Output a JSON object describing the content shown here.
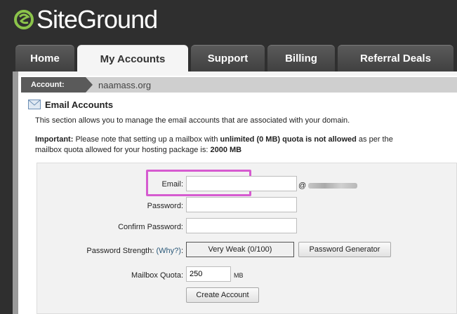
{
  "brand": {
    "name": "SiteGround",
    "accent": "#8bc34a"
  },
  "nav": {
    "tabs": [
      {
        "label": "Home"
      },
      {
        "label": "My Accounts",
        "active": true
      },
      {
        "label": "Support"
      },
      {
        "label": "Billing"
      },
      {
        "label": "Referral Deals"
      }
    ]
  },
  "breadcrumb": {
    "label": "Account:",
    "value": "naamass.org"
  },
  "section": {
    "title": "Email Accounts",
    "description": "This section allows you to manage the email accounts that are associated with your domain.",
    "important_prefix": "Important:",
    "important_text1": " Please note that setting up a mailbox with ",
    "important_bold": "unlimited (0 MB) quota is not allowed",
    "important_text2": " as per the",
    "important_line2": "mailbox quota allowed for your hosting package is: ",
    "important_quota": "2000 MB"
  },
  "form": {
    "email_label": "Email:",
    "email_value": "",
    "at_sign": "@",
    "password_label": "Password:",
    "confirm_label": "Confirm Password:",
    "strength_label": "Password Strength:",
    "why_label": "(Why?)",
    "strength_colon": ":",
    "strength_value": "Very Weak (0/100)",
    "generator_button": "Password Generator",
    "quota_label": "Mailbox Quota:",
    "quota_value": "250",
    "quota_unit": "MB",
    "create_button": "Create Account"
  }
}
